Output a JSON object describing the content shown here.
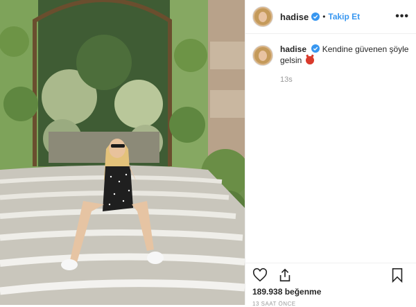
{
  "header": {
    "username": "hadise",
    "separator": "•",
    "follow_label": "Takip Et",
    "more_label": "•••"
  },
  "caption": {
    "username": "hadise",
    "text": "Kendine güvenen şöyle gelsin",
    "time": "13s"
  },
  "actions": {
    "likes": "189.938 beğenme",
    "posted": "13 SAAT ÖNCE"
  },
  "colors": {
    "link": "#3897f0",
    "verified": "#3897f0",
    "muted": "#999999"
  },
  "icons": [
    "heart-icon",
    "share-icon",
    "bookmark-icon",
    "verified-badge-icon",
    "more-options-icon"
  ]
}
